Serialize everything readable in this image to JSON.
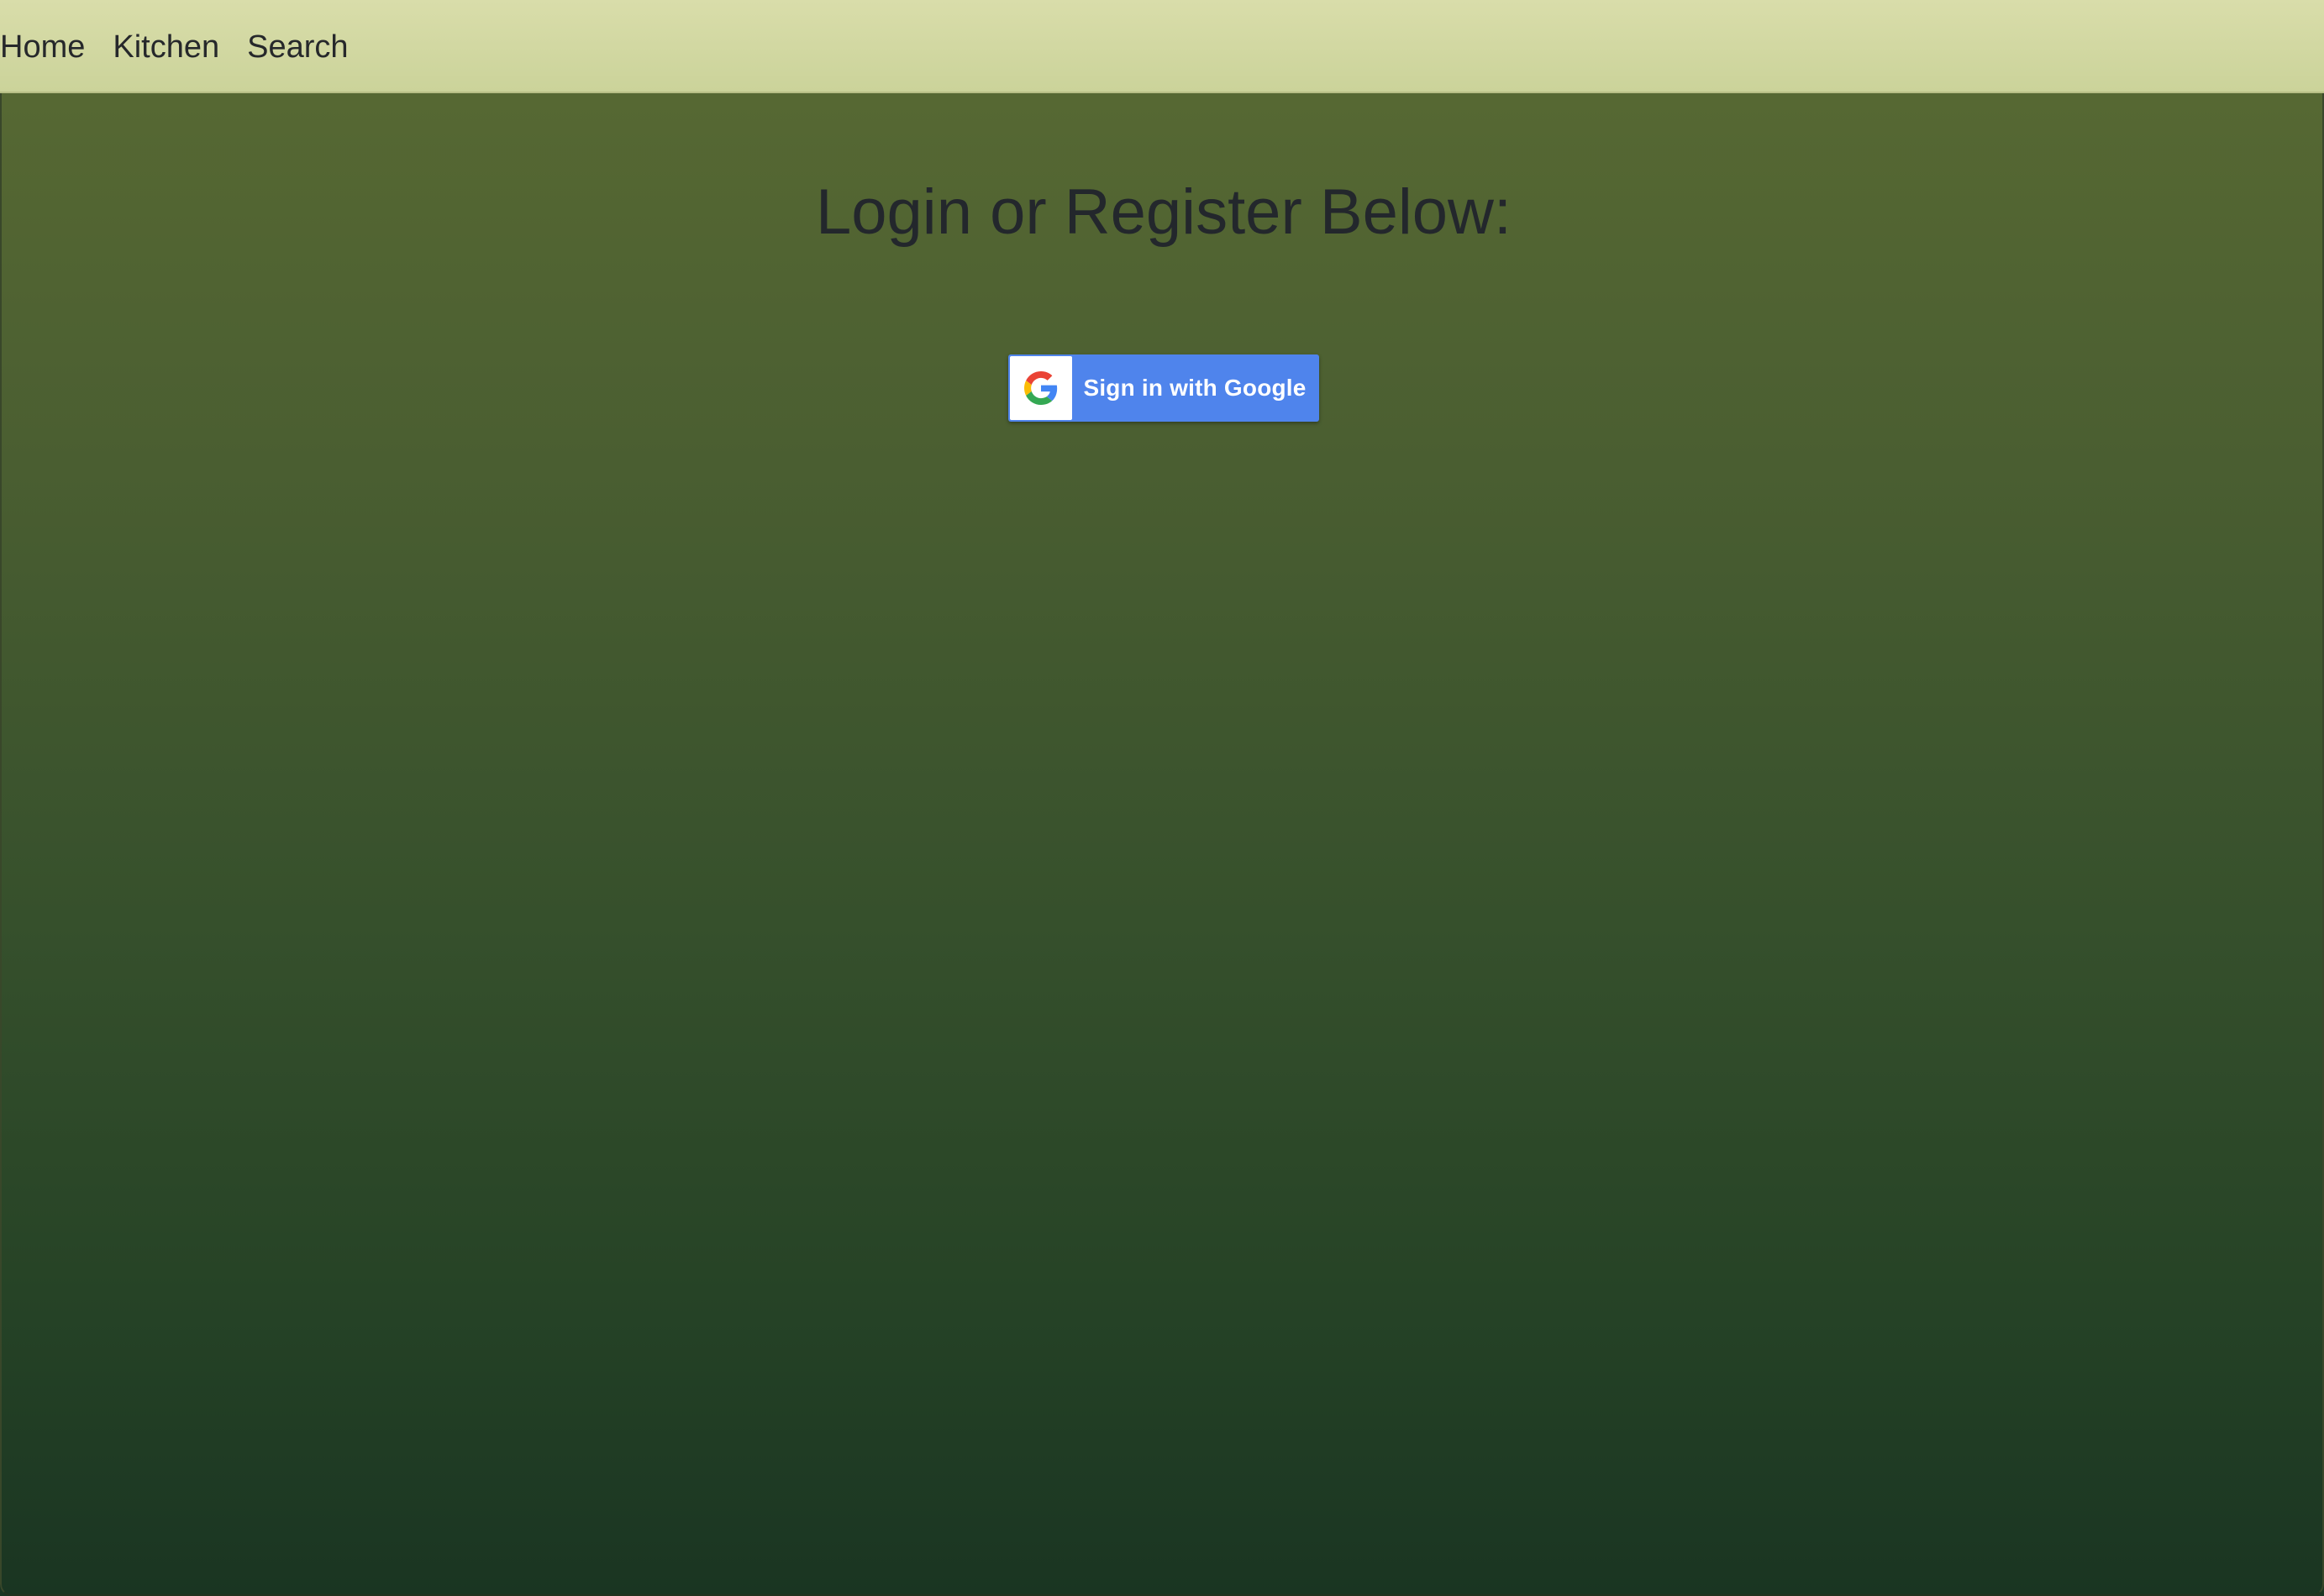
{
  "nav": {
    "items": [
      {
        "label": "Home"
      },
      {
        "label": "Kitchen"
      },
      {
        "label": "Search"
      }
    ]
  },
  "main": {
    "title": "Login or Register Below:",
    "google_button": {
      "label": "Sign in with Google",
      "icon": "google-g-icon"
    }
  },
  "colors": {
    "navbar_bg": "#d2d6a0",
    "gradient_top": "#566833",
    "gradient_bottom": "#1a3522",
    "button_blue": "#4f84ec",
    "title_text": "#23272c"
  }
}
